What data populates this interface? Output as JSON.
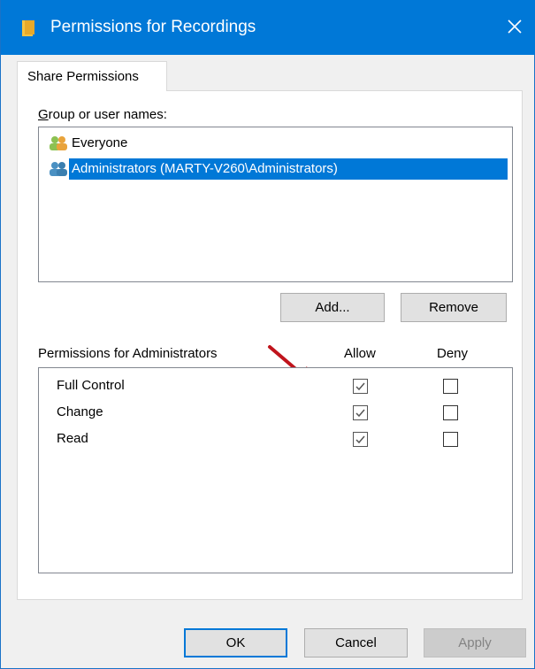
{
  "window": {
    "title": "Permissions for Recordings",
    "title_icon": "folder-icon",
    "close_icon": "close-icon"
  },
  "tabs": [
    {
      "label": "Share Permissions",
      "active": true
    }
  ],
  "group_section": {
    "label": "Group or user names:",
    "items": [
      {
        "name": "Everyone",
        "icon": "users-icon",
        "selected": false
      },
      {
        "name": "Administrators (MARTY-V260\\Administrators)",
        "icon": "users-icon",
        "selected": true
      }
    ],
    "add_label": "Add...",
    "remove_label": "Remove"
  },
  "permissions": {
    "label": "Permissions for Administrators",
    "allow_header": "Allow",
    "deny_header": "Deny",
    "rows": [
      {
        "name": "Full Control",
        "allow": true,
        "deny": false
      },
      {
        "name": "Change",
        "allow": true,
        "deny": false
      },
      {
        "name": "Read",
        "allow": true,
        "deny": false
      }
    ]
  },
  "annotation": {
    "arrow_icon": "red-arrow-icon",
    "arrow_color": "#c0141c"
  },
  "buttons": {
    "ok": "OK",
    "cancel": "Cancel",
    "apply": "Apply"
  },
  "colors": {
    "title_bar": "#0078d7",
    "selection": "#0078d7"
  }
}
